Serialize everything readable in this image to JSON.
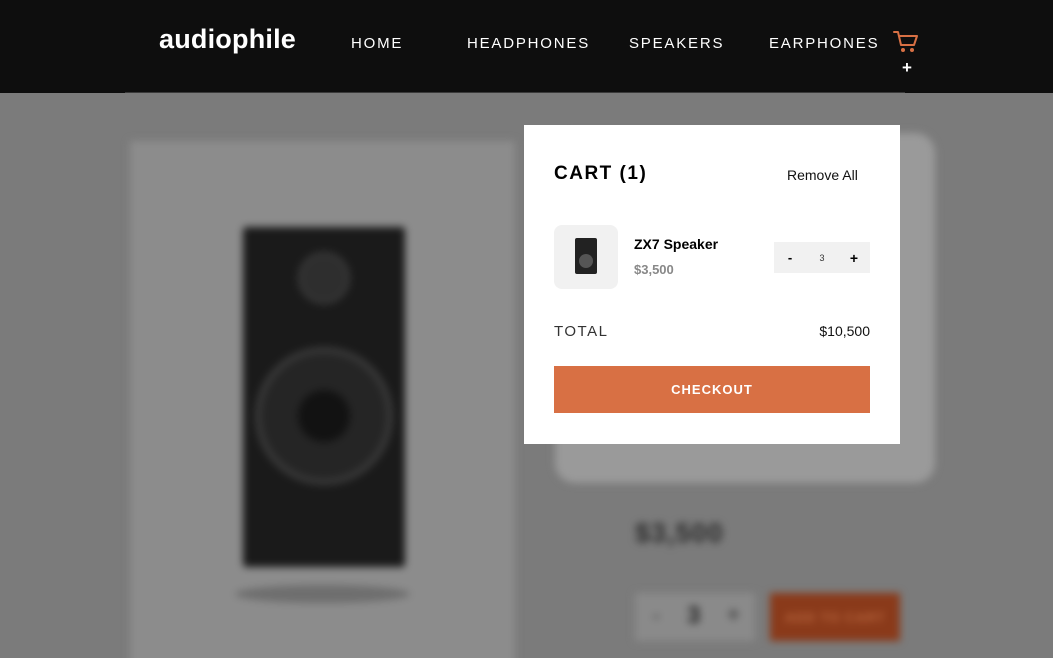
{
  "header": {
    "logo": "audiophile",
    "nav": [
      {
        "label": "HOME"
      },
      {
        "label": "HEADPHONES"
      },
      {
        "label": "SPEAKERS"
      },
      {
        "label": "EARPHONES"
      }
    ],
    "cart_icon": "shopping-cart-icon",
    "cart_plus": "+"
  },
  "background_page": {
    "price": "$3,500",
    "quantity": {
      "minus": "-",
      "value": "3",
      "plus": "+"
    },
    "add_to_cart": "ADD TO CART"
  },
  "cart": {
    "title": "CART (1)",
    "remove_all": "Remove All",
    "items": [
      {
        "name": "ZX7 Speaker",
        "price": "$3,500",
        "minus": "-",
        "quantity": "3",
        "plus": "+"
      }
    ],
    "total_label": "TOTAL",
    "total_value": "$10,500",
    "checkout_label": "CHECKOUT"
  },
  "colors": {
    "accent": "#D87044",
    "header_bg": "#0E0E0E",
    "overlay": "#7B7B7B"
  }
}
